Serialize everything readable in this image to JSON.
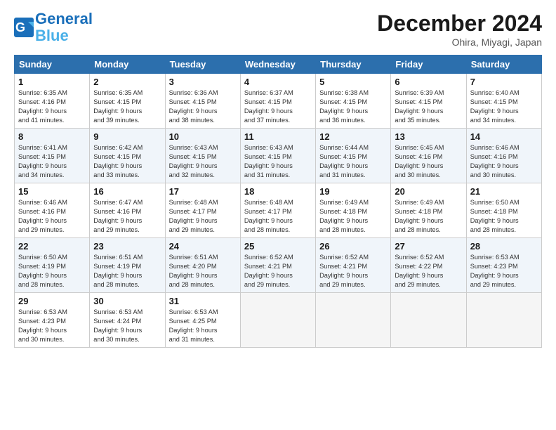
{
  "header": {
    "logo_line1": "General",
    "logo_line2": "Blue",
    "month": "December 2024",
    "location": "Ohira, Miyagi, Japan"
  },
  "weekdays": [
    "Sunday",
    "Monday",
    "Tuesday",
    "Wednesday",
    "Thursday",
    "Friday",
    "Saturday"
  ],
  "weeks": [
    [
      {
        "day": "1",
        "info": "Sunrise: 6:35 AM\nSunset: 4:16 PM\nDaylight: 9 hours\nand 41 minutes."
      },
      {
        "day": "2",
        "info": "Sunrise: 6:35 AM\nSunset: 4:15 PM\nDaylight: 9 hours\nand 39 minutes."
      },
      {
        "day": "3",
        "info": "Sunrise: 6:36 AM\nSunset: 4:15 PM\nDaylight: 9 hours\nand 38 minutes."
      },
      {
        "day": "4",
        "info": "Sunrise: 6:37 AM\nSunset: 4:15 PM\nDaylight: 9 hours\nand 37 minutes."
      },
      {
        "day": "5",
        "info": "Sunrise: 6:38 AM\nSunset: 4:15 PM\nDaylight: 9 hours\nand 36 minutes."
      },
      {
        "day": "6",
        "info": "Sunrise: 6:39 AM\nSunset: 4:15 PM\nDaylight: 9 hours\nand 35 minutes."
      },
      {
        "day": "7",
        "info": "Sunrise: 6:40 AM\nSunset: 4:15 PM\nDaylight: 9 hours\nand 34 minutes."
      }
    ],
    [
      {
        "day": "8",
        "info": "Sunrise: 6:41 AM\nSunset: 4:15 PM\nDaylight: 9 hours\nand 34 minutes."
      },
      {
        "day": "9",
        "info": "Sunrise: 6:42 AM\nSunset: 4:15 PM\nDaylight: 9 hours\nand 33 minutes."
      },
      {
        "day": "10",
        "info": "Sunrise: 6:43 AM\nSunset: 4:15 PM\nDaylight: 9 hours\nand 32 minutes."
      },
      {
        "day": "11",
        "info": "Sunrise: 6:43 AM\nSunset: 4:15 PM\nDaylight: 9 hours\nand 31 minutes."
      },
      {
        "day": "12",
        "info": "Sunrise: 6:44 AM\nSunset: 4:15 PM\nDaylight: 9 hours\nand 31 minutes."
      },
      {
        "day": "13",
        "info": "Sunrise: 6:45 AM\nSunset: 4:16 PM\nDaylight: 9 hours\nand 30 minutes."
      },
      {
        "day": "14",
        "info": "Sunrise: 6:46 AM\nSunset: 4:16 PM\nDaylight: 9 hours\nand 30 minutes."
      }
    ],
    [
      {
        "day": "15",
        "info": "Sunrise: 6:46 AM\nSunset: 4:16 PM\nDaylight: 9 hours\nand 29 minutes."
      },
      {
        "day": "16",
        "info": "Sunrise: 6:47 AM\nSunset: 4:16 PM\nDaylight: 9 hours\nand 29 minutes."
      },
      {
        "day": "17",
        "info": "Sunrise: 6:48 AM\nSunset: 4:17 PM\nDaylight: 9 hours\nand 29 minutes."
      },
      {
        "day": "18",
        "info": "Sunrise: 6:48 AM\nSunset: 4:17 PM\nDaylight: 9 hours\nand 28 minutes."
      },
      {
        "day": "19",
        "info": "Sunrise: 6:49 AM\nSunset: 4:18 PM\nDaylight: 9 hours\nand 28 minutes."
      },
      {
        "day": "20",
        "info": "Sunrise: 6:49 AM\nSunset: 4:18 PM\nDaylight: 9 hours\nand 28 minutes."
      },
      {
        "day": "21",
        "info": "Sunrise: 6:50 AM\nSunset: 4:18 PM\nDaylight: 9 hours\nand 28 minutes."
      }
    ],
    [
      {
        "day": "22",
        "info": "Sunrise: 6:50 AM\nSunset: 4:19 PM\nDaylight: 9 hours\nand 28 minutes."
      },
      {
        "day": "23",
        "info": "Sunrise: 6:51 AM\nSunset: 4:19 PM\nDaylight: 9 hours\nand 28 minutes."
      },
      {
        "day": "24",
        "info": "Sunrise: 6:51 AM\nSunset: 4:20 PM\nDaylight: 9 hours\nand 28 minutes."
      },
      {
        "day": "25",
        "info": "Sunrise: 6:52 AM\nSunset: 4:21 PM\nDaylight: 9 hours\nand 29 minutes."
      },
      {
        "day": "26",
        "info": "Sunrise: 6:52 AM\nSunset: 4:21 PM\nDaylight: 9 hours\nand 29 minutes."
      },
      {
        "day": "27",
        "info": "Sunrise: 6:52 AM\nSunset: 4:22 PM\nDaylight: 9 hours\nand 29 minutes."
      },
      {
        "day": "28",
        "info": "Sunrise: 6:53 AM\nSunset: 4:23 PM\nDaylight: 9 hours\nand 29 minutes."
      }
    ],
    [
      {
        "day": "29",
        "info": "Sunrise: 6:53 AM\nSunset: 4:23 PM\nDaylight: 9 hours\nand 30 minutes."
      },
      {
        "day": "30",
        "info": "Sunrise: 6:53 AM\nSunset: 4:24 PM\nDaylight: 9 hours\nand 30 minutes."
      },
      {
        "day": "31",
        "info": "Sunrise: 6:53 AM\nSunset: 4:25 PM\nDaylight: 9 hours\nand 31 minutes."
      },
      null,
      null,
      null,
      null
    ]
  ]
}
